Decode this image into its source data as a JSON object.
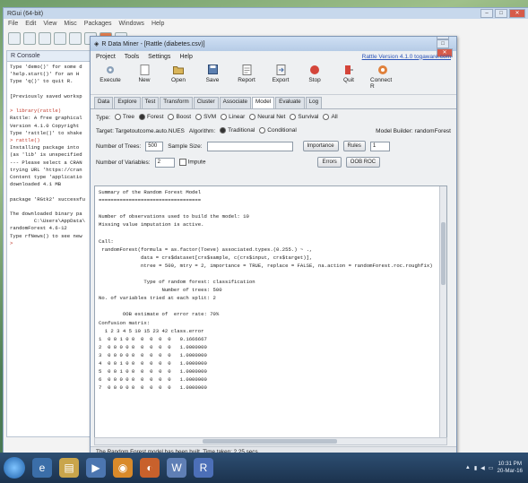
{
  "rgui": {
    "title": "RGui (64-bit)",
    "menu": [
      "File",
      "Edit",
      "View",
      "Misc",
      "Packages",
      "Windows",
      "Help"
    ],
    "console_title": "R Console",
    "console_lines": [
      "Type 'demo()' for some d",
      "'help.start()' for an H",
      "Type 'q()' to quit R.",
      "",
      "[Previously saved worksp",
      "",
      "> library(rattle)",
      "Rattle: A free graphical",
      "Version 4.1.0 Copyright",
      "Type 'rattle()' to shake",
      "> rattle()",
      "Installing package into",
      "(as 'lib' is unspecified",
      "--- Please select a CRAN",
      "trying URL 'https://cran",
      "Content type 'applicatio",
      "downloaded 4.1 MB",
      "",
      "package 'RGtk2' successfu",
      "",
      "The downloaded binary pa",
      "        C:\\Users\\AppData\\",
      "randomForest 4.6-12",
      "Type rfNews() to see new",
      ">"
    ]
  },
  "rattle": {
    "title": "R Data Miner - [Rattle (diabetes.csv)]",
    "menu": [
      "Project",
      "Tools",
      "Settings",
      "Help"
    ],
    "version_link": "Rattle Version 4.1.0 togaware.com",
    "toolbar": [
      "Execute",
      "New",
      "Open",
      "Save",
      "Report",
      "Export",
      "Stop",
      "Quit",
      "Connect R"
    ],
    "tabs": [
      "Data",
      "Explore",
      "Test",
      "Transform",
      "Cluster",
      "Associate",
      "Model",
      "Evaluate",
      "Log"
    ],
    "active_tab": "Model",
    "type_label": "Type:",
    "type_options": [
      "Tree",
      "Forest",
      "Boost",
      "SVM",
      "Linear",
      "Neural Net",
      "Survival",
      "All"
    ],
    "type_selected": "Forest",
    "target_label": "Target: Targetoutcome.auto.NUES",
    "algorithm_label": "Algorithm:",
    "algorithm_options": [
      "Traditional",
      "Conditional"
    ],
    "algorithm_selected": "Traditional",
    "model_builder": "Model Builder: randomForest",
    "num_trees_label": "Number of Trees:",
    "num_trees_value": "500",
    "sample_size_label": "Sample Size:",
    "sample_size_value": "",
    "importance_button": "Importance",
    "rules_button": "Rules",
    "rules_value": "1",
    "num_vars_label": "Number of Variables:",
    "num_vars_value": "2",
    "impute_label": "Impute",
    "errors_button": "Errors",
    "oob_button": "OOB ROC",
    "status": "The Random Forest model has been built. Time taken: 2.25 secs"
  },
  "output_lines": [
    "Summary of the Random Forest Model",
    "==================================",
    "",
    "Number of observations used to build the model: 10",
    "Missing value imputation is active.",
    "",
    "Call:",
    " randomForest(formula = as.factor(Toeve) associated.types.(0.255.) ~ .,",
    "              data = crs$dataset[crs$sample, c(crs$input, crs$target)],",
    "              ntree = 500, mtry = 2, importance = TRUE, replace = FALSE, na.action = randomForest.roc.roughfix)",
    "",
    "               Type of random forest: classification",
    "                     Number of trees: 500",
    "No. of variables tried at each split: 2",
    "",
    "        OOB estimate of  error rate: 70%",
    "Confusion matrix:",
    "  1 2 3 4 5 10 15 23 42 class.error",
    "1  0 0 1 0 0  0  0  0  0   0.1666667",
    "2  0 0 0 0 0  0  0  0  0   1.0000000",
    "3  0 0 0 0 0  0  0  0  0   1.0000000",
    "4  0 0 1 0 0  0  0  0  0   1.0000000",
    "5  0 0 1 0 0  0  0  0  0   1.0000000",
    "6  0 0 0 0 0  0  0  0  0   1.0000000",
    "7  0 0 0 0 0  0  0  0  0   1.0000000"
  ],
  "taskbar": {
    "clock_time": "10:31 PM",
    "clock_date": "20-Mar-16"
  },
  "colors": {
    "title_bar": "#b6cbe6",
    "accent_red": "#d65b4a",
    "link_blue": "#2b54b8"
  }
}
